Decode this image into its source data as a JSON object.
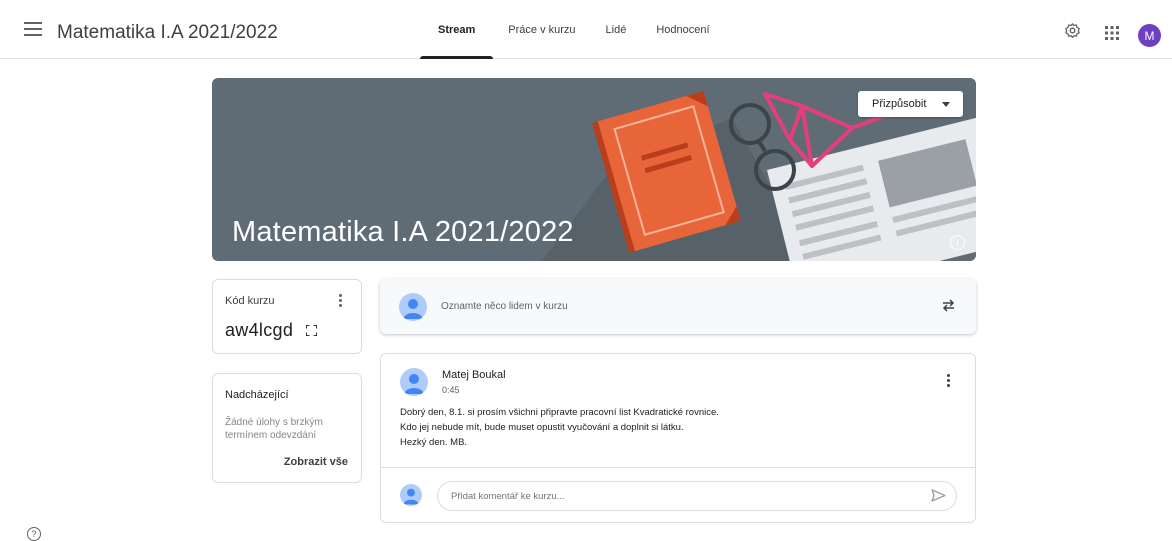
{
  "header": {
    "course_title": "Matematika I.A 2021/2022",
    "tabs": [
      {
        "label": "Stream",
        "active": true
      },
      {
        "label": "Práce v kurzu",
        "active": false
      },
      {
        "label": "Lidé",
        "active": false
      },
      {
        "label": "Hodnocení",
        "active": false
      }
    ],
    "icons": [
      "menu-icon",
      "gear-icon",
      "apps-grid-icon"
    ],
    "avatar_letter": "M"
  },
  "banner": {
    "title": "Matematika I.A 2021/2022",
    "customize_label": "Přizpůsobit",
    "info_glyph": "i",
    "colors": {
      "background": "#5f6b75",
      "book": "#e8653a",
      "glasses": "#e33f7d"
    }
  },
  "class_code": {
    "label": "Kód kurzu",
    "value": "aw4lcgd"
  },
  "upcoming": {
    "title": "Nadcházející",
    "text": "Žádné úlohy s brzkým termínem odevzdání",
    "view_all": "Zobrazit vše"
  },
  "announce": {
    "placeholder": "Oznamte něco lidem v kurzu"
  },
  "post": {
    "author": "Matej Boukal",
    "time": "0:45",
    "lines": [
      "Dobrý den, 8.1. si prosím všichni připravte pracovní list Kvadratické rovnice.",
      "Kdo jej nebude mít, bude muset opustit vyučování a doplnit si látku.",
      "Hezký den. MB."
    ],
    "comment_placeholder": "Přidat komentář ke kurzu..."
  },
  "help_glyph": "?"
}
